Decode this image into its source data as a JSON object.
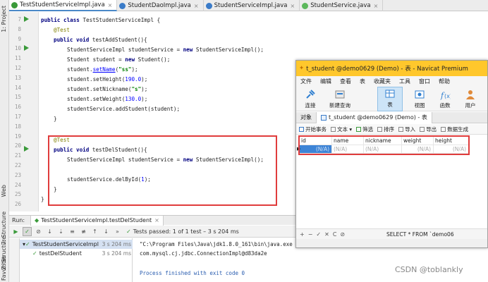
{
  "side_labels": [
    "1: Project",
    "Web",
    "7: Structure",
    "Z: Structure",
    "2: Favorites"
  ],
  "tabs": [
    {
      "label": "TestStudentServiceImpl.java",
      "color": "#3a9a3a",
      "active": true
    },
    {
      "label": "StudentDaoImpl.java",
      "color": "#3a7bc8",
      "active": false
    },
    {
      "label": "StudentServiceImpl.java",
      "color": "#3a7bc8",
      "active": false
    },
    {
      "label": "StudentService.java",
      "color": "#5cb85c",
      "active": false
    }
  ],
  "line_numbers": [
    "7",
    "8",
    "9",
    "10",
    "11",
    "12",
    "13",
    "14",
    "15",
    "16",
    "17",
    "18",
    "19",
    "20",
    "21",
    "22",
    "23",
    "24",
    "25",
    "26"
  ],
  "code": {
    "l7_kw": "public class ",
    "l7_rest": "TestStudentServiceImpl {",
    "l8": "@Test",
    "l9_kw": "public void ",
    "l9_rest": "testAddStudent(){",
    "l10_a": "StudentServiceImpl studentService = ",
    "l10_kw": "new ",
    "l10_b": "StudentServiceImpl();",
    "l11_a": "Student student = ",
    "l11_kw": "new ",
    "l11_b": "Student();",
    "l12_a": "student.",
    "l12_link": "setName",
    "l12_b": "(",
    "l12_str": "\"ss\"",
    "l12_c": ");",
    "l13_a": "student.setHeight(",
    "l13_num": "190.0",
    "l13_b": ");",
    "l14_a": "student.setNickname(",
    "l14_str": "\"s\"",
    "l14_b": ");",
    "l15_a": "student.setWeight(",
    "l15_num": "130.0",
    "l15_b": ");",
    "l16": "studentService.addStudent(student);",
    "l17": "}",
    "l19": "@Test",
    "l20_kw": "public void ",
    "l20_rest": "testDelStudent(){",
    "l21_a": "StudentServiceImpl studentService = ",
    "l21_kw": "new ",
    "l21_b": "StudentServiceImpl();",
    "l23_a": "studentService.delById(",
    "l23_num": "1",
    "l23_b": ");",
    "l24": "}",
    "l25": "}"
  },
  "run": {
    "label": "Run:",
    "config": "TestStudentServiceImpl.testDelStudent",
    "passed_prefix": "Tests passed: ",
    "passed_count": "1",
    "passed_suffix": " of 1 test – 3 s 204 ms",
    "tree": [
      {
        "label": "TestStudentServiceImpl",
        "time": "3 s 204 ms"
      },
      {
        "label": "testDelStudent",
        "time": "3 s 204 ms"
      }
    ],
    "console": [
      "\"C:\\Program Files\\Java\\jdk1.8.0_161\\bin\\java.exe",
      "com.mysql.cj.jdbc.ConnectionImpl@d83da2e",
      "",
      "Process finished with exit code 0"
    ]
  },
  "navicat": {
    "title": "t_student @demo0629 (Demo) - 表 - Navicat Premium",
    "menu": [
      "文件",
      "编辑",
      "查看",
      "表",
      "收藏夹",
      "工具",
      "窗口",
      "帮助"
    ],
    "tools": [
      "连接",
      "新建查询",
      "表",
      "视图",
      "函数",
      "用户"
    ],
    "tab_objects": "对象",
    "tab_table": "t_student @demo0629 (Demo) - 表",
    "actions": [
      "开始事务",
      "文本 ▾",
      "筛选",
      "排序",
      "导入",
      "导出",
      "数据生成"
    ],
    "columns": [
      "id",
      "name",
      "nickname",
      "weight",
      "height"
    ],
    "row": [
      "(N/A)",
      "(N/A)",
      "(N/A)",
      "(N/A)",
      "(N/A)"
    ],
    "bottom_buttons": [
      "+",
      "−",
      "✓",
      "✕",
      "C",
      "⊘"
    ],
    "sql": "SELECT * FROM `demo06"
  },
  "watermark": "CSDN @toblankly"
}
